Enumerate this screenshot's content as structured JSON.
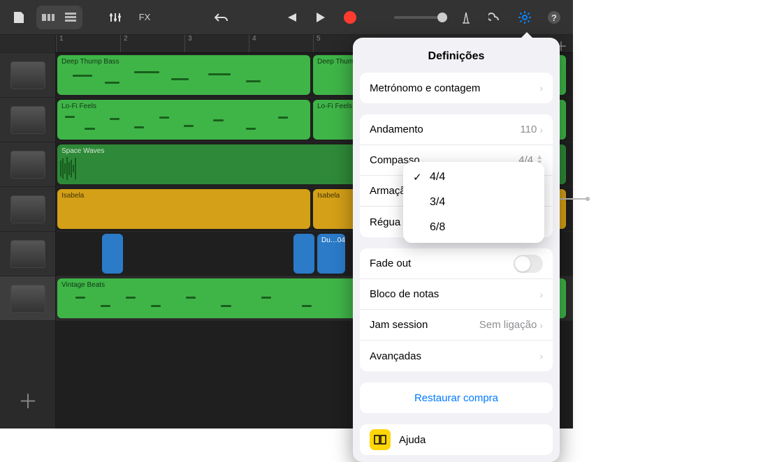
{
  "toolbar": {
    "fx_label": "FX"
  },
  "ruler": {
    "marks": [
      "1",
      "2",
      "3",
      "4",
      "5"
    ]
  },
  "tracks": [
    {
      "name": "Deep Thump Bass",
      "color": "green"
    },
    {
      "name": "Lo-Fi Feels",
      "color": "green"
    },
    {
      "name": "Space Waves",
      "color": "dgreen"
    },
    {
      "name": "Isabela",
      "color": "yellow"
    },
    {
      "name": "Du…04",
      "color": "blue"
    },
    {
      "name": "Vintage Beats",
      "color": "green"
    }
  ],
  "settings": {
    "title": "Definições",
    "metronome": "Metrónomo e contagem",
    "tempo_label": "Andamento",
    "tempo_value": "110",
    "timesig_label": "Compasso",
    "timesig_value": "4/4",
    "keysig_label": "Armação",
    "ruler_label": "Régua d",
    "fadeout": "Fade out",
    "notepad": "Bloco de notas",
    "jam_label": "Jam session",
    "jam_value": "Sem ligação",
    "advanced": "Avançadas",
    "restore": "Restaurar compra",
    "help": "Ajuda"
  },
  "dropdown": {
    "options": [
      "4/4",
      "3/4",
      "6/8"
    ],
    "selected": "4/4"
  },
  "chart_data": null
}
